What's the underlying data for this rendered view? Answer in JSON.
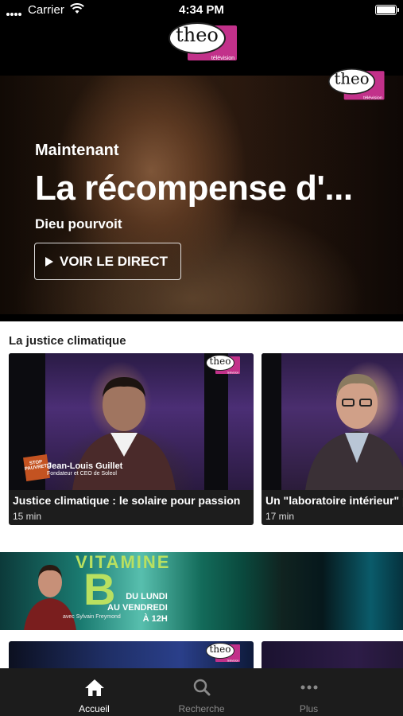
{
  "status_bar": {
    "carrier": "Carrier",
    "time": "4:34 PM"
  },
  "brand": {
    "logo_word": "theo",
    "logo_sub": "télévision"
  },
  "hero": {
    "kicker": "Maintenant",
    "title": "La récompense d'...",
    "subtitle": "Dieu pourvoit",
    "button_label": "VOIR LE DIRECT"
  },
  "section": {
    "title": "La justice climatique",
    "cards": [
      {
        "title": "Justice climatique : le solaire pour passion",
        "duration": "15 min",
        "name": "Jean-Louis Guillet",
        "role": "Fondateur et CEO de Soleol",
        "badge": "STOP PAUVRETÉ"
      },
      {
        "title": "Un \"laboratoire intérieur\" p",
        "duration": "17 min"
      }
    ]
  },
  "banner": {
    "word": "VITAMINE",
    "letter": "B",
    "days_line1": "DU LUNDI",
    "days_line2": "AU VENDREDI",
    "days_line3": "À 12H",
    "host": "avec Sylvain Freymond"
  },
  "tabs": [
    {
      "label": "Accueil",
      "icon": "home-icon",
      "active": true
    },
    {
      "label": "Recherche",
      "icon": "search-icon",
      "active": false
    },
    {
      "label": "Plus",
      "icon": "more-icon",
      "active": false
    }
  ],
  "colors": {
    "accent": "#c2318a",
    "tabbar": "#1c1c1c",
    "banner_text": "#b9e060"
  }
}
